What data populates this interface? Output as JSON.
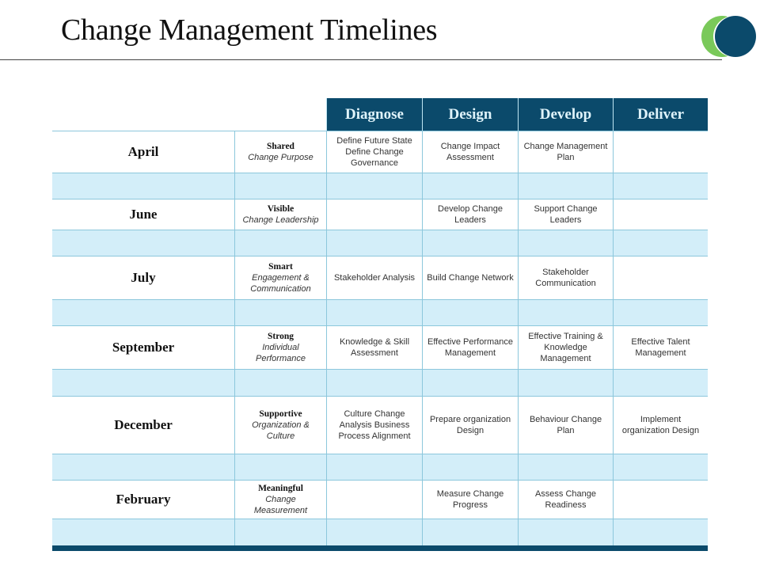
{
  "title": "Change Management Timelines",
  "logo": {
    "icon": "overlapping-circles-logo",
    "colors": [
      "#7ac95a",
      "#0b4a6b"
    ]
  },
  "table": {
    "headers": [
      "Diagnose",
      "Design",
      "Develop",
      "Deliver"
    ],
    "rows": [
      {
        "month": "April",
        "theme_bold": "Shared",
        "theme_italic": "Change Purpose",
        "cells": [
          "Define Future State Define Change Governance",
          "Change Impact Assessment",
          "Change Management Plan",
          ""
        ]
      },
      {
        "month": "June",
        "theme_bold": "Visible",
        "theme_italic": "Change Leadership",
        "cells": [
          "",
          "Develop Change Leaders",
          "Support Change Leaders",
          ""
        ]
      },
      {
        "month": "July",
        "theme_bold": "Smart",
        "theme_italic": "Engagement & Communication",
        "cells": [
          "Stakeholder Analysis",
          "Build Change Network",
          "Stakeholder Communication",
          ""
        ]
      },
      {
        "month": "September",
        "theme_bold": "Strong",
        "theme_italic": "Individual Performance",
        "cells": [
          "Knowledge & Skill Assessment",
          "Effective Performance Management",
          "Effective Training & Knowledge Management",
          "Effective Talent Management"
        ]
      },
      {
        "month": "December",
        "theme_bold": "Supportive",
        "theme_italic": "Organization & Culture",
        "cells": [
          "Culture Change Analysis Business Process Alignment",
          "Prepare organization Design",
          "Behaviour Change Plan",
          "Implement organization Design"
        ]
      },
      {
        "month": "February",
        "theme_bold": "Meaningful",
        "theme_italic": "Change Measurement",
        "cells": [
          "",
          "Measure Change Progress",
          "Assess Change Readiness",
          ""
        ]
      }
    ]
  },
  "colors": {
    "header_bg": "#0b4a6b",
    "header_text": "#dff3fa",
    "band": "#d3eef9",
    "grid_line": "#8cc7dc"
  }
}
